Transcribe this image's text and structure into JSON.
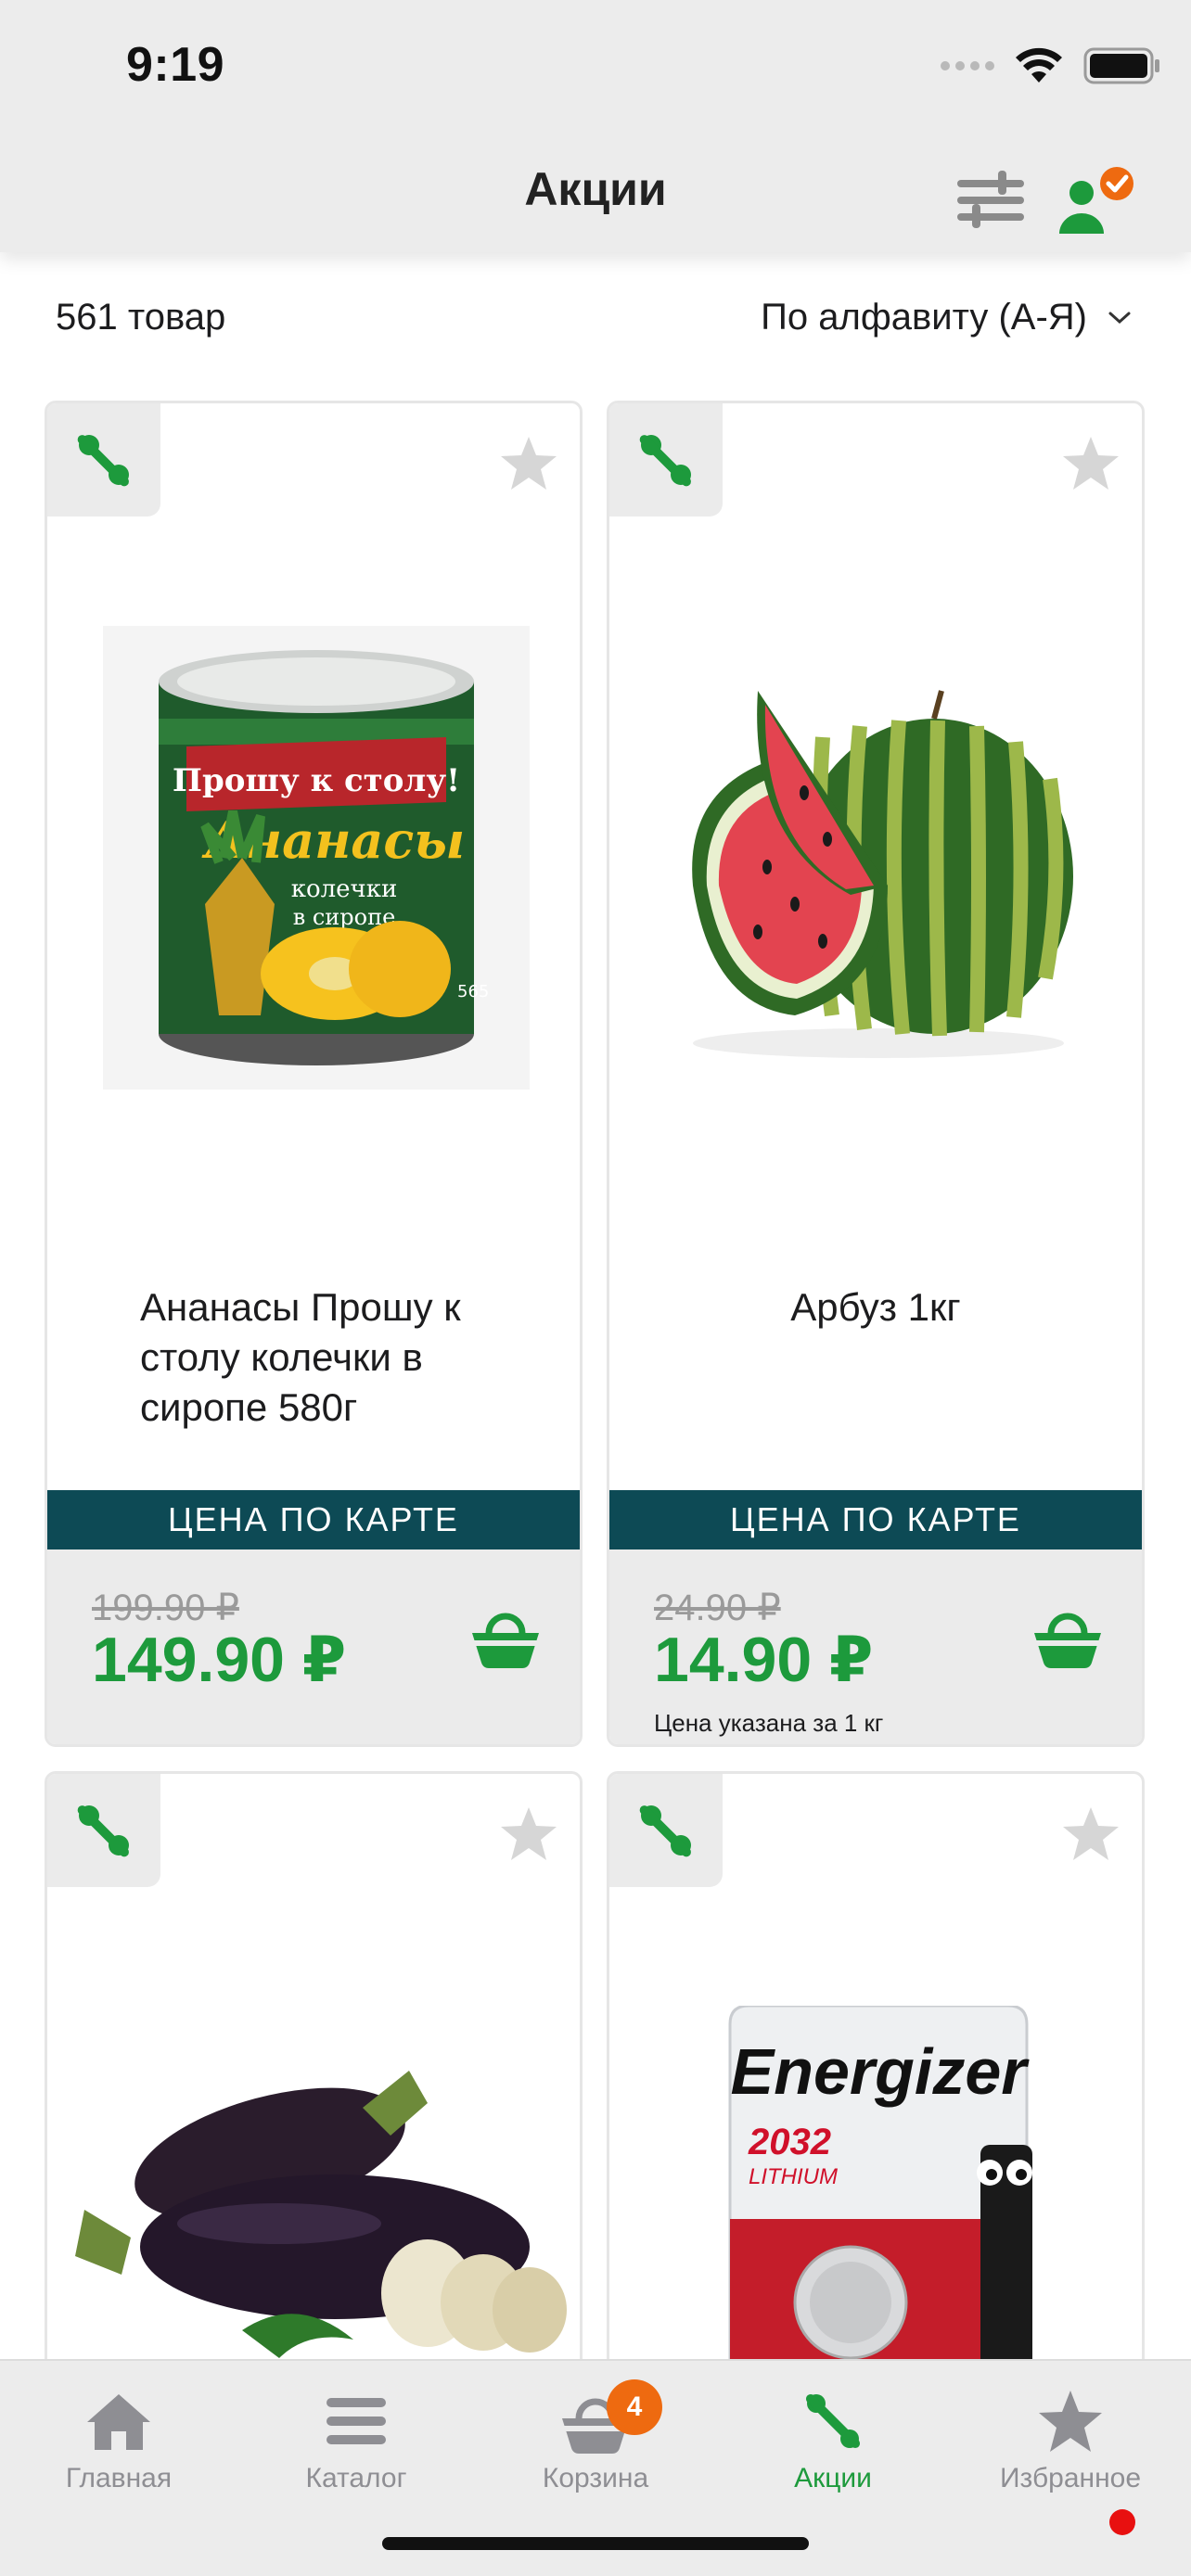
{
  "status": {
    "time": "9:19"
  },
  "header": {
    "title": "Акции"
  },
  "list": {
    "count": "561 товар",
    "sort": "По алфавиту (А-Я)"
  },
  "products": [
    {
      "name": "Ананасы Прошу к столу колечки в сиропе 580г",
      "label": "ЦЕНА ПО КАРТЕ",
      "old_price": "199.90 ₽",
      "price": "149.90 ₽",
      "note": "",
      "image": "pineapple-can-image",
      "can_brand": "Прошу к столу!",
      "can_title": "Ананасы",
      "can_sub1": "колечки",
      "can_sub2": "в сиропе",
      "can_weight": "565"
    },
    {
      "name": "Арбуз 1кг",
      "label": "ЦЕНА ПО КАРТЕ",
      "old_price": "24.90 ₽",
      "price": "14.90 ₽",
      "note": "Цена указана за 1 кг",
      "image": "watermelon-image"
    },
    {
      "name": "",
      "image": "eggplant-image"
    },
    {
      "name": "",
      "image": "energizer-battery-image",
      "brand": "Energizer",
      "model": "2032",
      "type": "LITHIUM"
    }
  ],
  "tabs": [
    {
      "label": "Главная",
      "icon": "home-icon"
    },
    {
      "label": "Каталог",
      "icon": "catalog-icon"
    },
    {
      "label": "Корзина",
      "icon": "basket-icon",
      "badge": "4"
    },
    {
      "label": "Акции",
      "icon": "percent-icon",
      "active": true
    },
    {
      "label": "Избранное",
      "icon": "star-icon"
    }
  ],
  "colors": {
    "accent": "#1d9a3c",
    "label_bg": "#0d4a55",
    "badge": "#ee6a10",
    "dot": "#e81010"
  }
}
